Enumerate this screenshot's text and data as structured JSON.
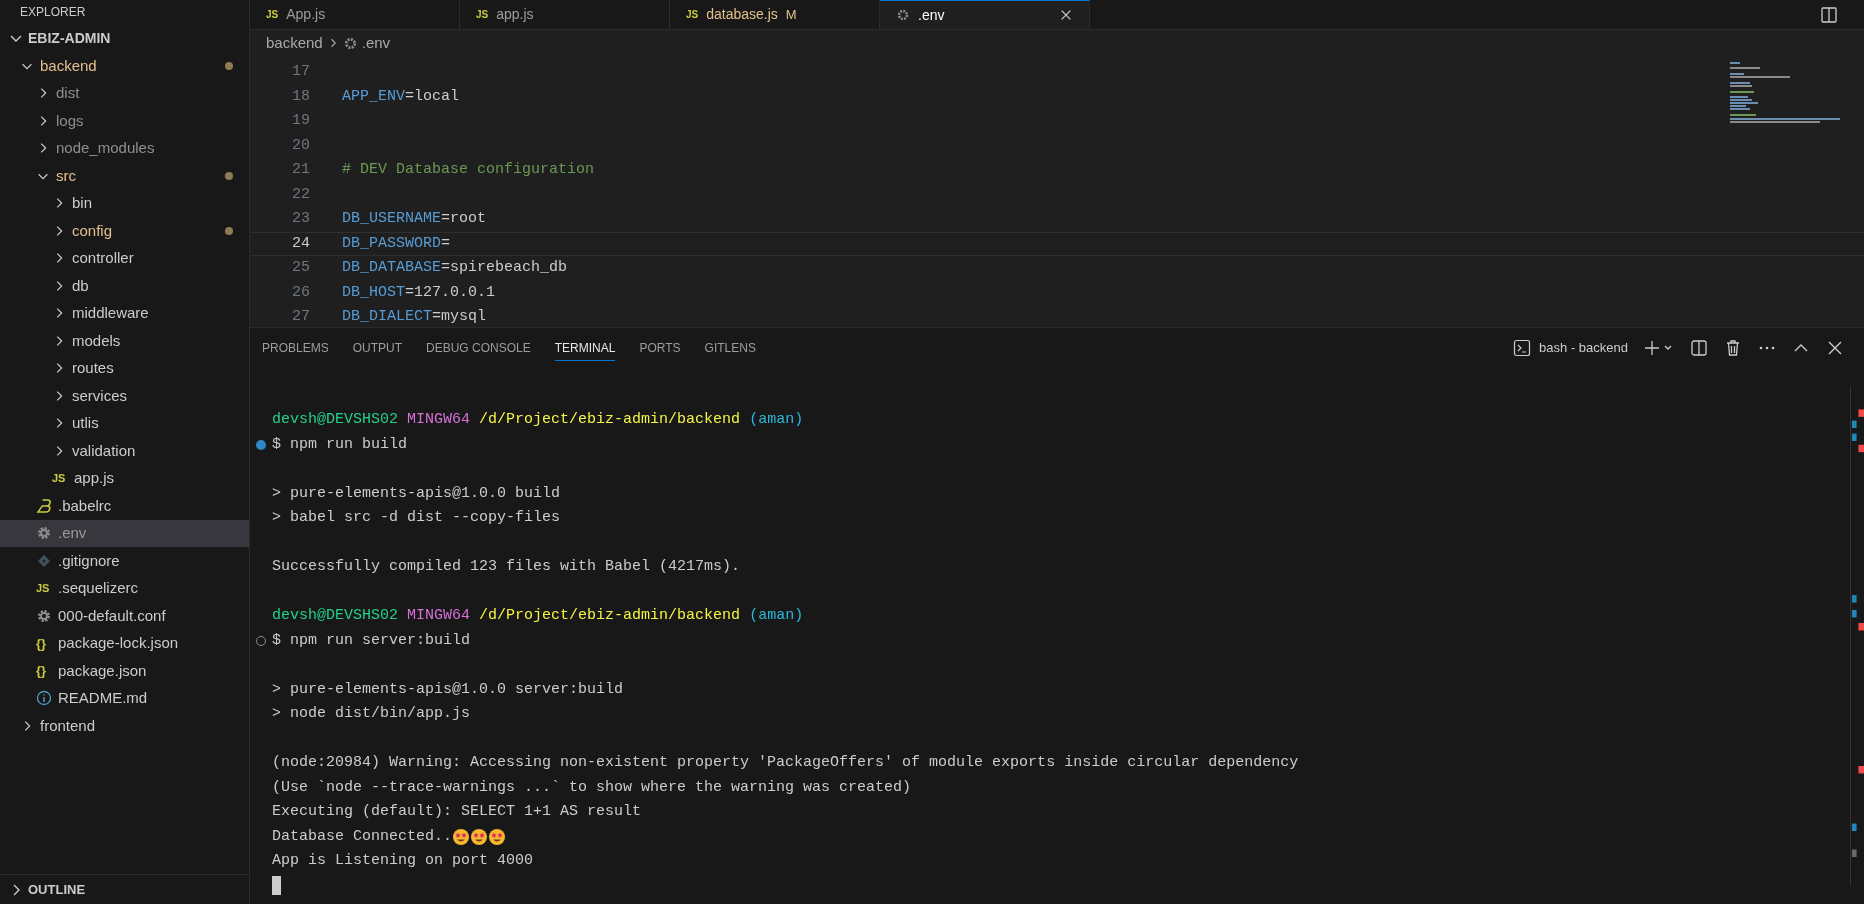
{
  "sidebar": {
    "title": "EXPLORER",
    "root": "EBIZ-ADMIN",
    "tree": [
      {
        "label": "backend",
        "kind": "folder",
        "expanded": true,
        "modified": true,
        "ignored": false,
        "selected": false,
        "children": [
          {
            "label": "dist",
            "kind": "folder",
            "expanded": false,
            "modified": false,
            "ignored": true,
            "selected": false
          },
          {
            "label": "logs",
            "kind": "folder",
            "expanded": false,
            "modified": false,
            "ignored": true,
            "selected": false
          },
          {
            "label": "node_modules",
            "kind": "folder",
            "expanded": false,
            "modified": false,
            "ignored": true,
            "selected": false
          },
          {
            "label": "src",
            "kind": "folder",
            "expanded": true,
            "modified": true,
            "ignored": false,
            "selected": false,
            "children": [
              {
                "label": "bin",
                "kind": "folder",
                "expanded": false,
                "modified": false,
                "ignored": false,
                "selected": false
              },
              {
                "label": "config",
                "kind": "folder",
                "expanded": false,
                "modified": true,
                "ignored": false,
                "selected": false
              },
              {
                "label": "controller",
                "kind": "folder",
                "expanded": false,
                "modified": false,
                "ignored": false,
                "selected": false
              },
              {
                "label": "db",
                "kind": "folder",
                "expanded": false,
                "modified": false,
                "ignored": false,
                "selected": false
              },
              {
                "label": "middleware",
                "kind": "folder",
                "expanded": false,
                "modified": false,
                "ignored": false,
                "selected": false
              },
              {
                "label": "models",
                "kind": "folder",
                "expanded": false,
                "modified": false,
                "ignored": false,
                "selected": false
              },
              {
                "label": "routes",
                "kind": "folder",
                "expanded": false,
                "modified": false,
                "ignored": false,
                "selected": false
              },
              {
                "label": "services",
                "kind": "folder",
                "expanded": false,
                "modified": false,
                "ignored": false,
                "selected": false
              },
              {
                "label": "utlis",
                "kind": "folder",
                "expanded": false,
                "modified": false,
                "ignored": false,
                "selected": false
              },
              {
                "label": "validation",
                "kind": "folder",
                "expanded": false,
                "modified": false,
                "ignored": false,
                "selected": false
              },
              {
                "label": "app.js",
                "kind": "js",
                "icon": "JS",
                "modified": false,
                "ignored": false,
                "selected": false
              }
            ]
          },
          {
            "label": ".babelrc",
            "kind": "babel",
            "modified": false,
            "ignored": false,
            "selected": false
          },
          {
            "label": ".env",
            "kind": "gear",
            "modified": false,
            "ignored": true,
            "selected": true
          },
          {
            "label": ".gitignore",
            "kind": "git",
            "modified": false,
            "ignored": false,
            "selected": false
          },
          {
            "label": ".sequelizerc",
            "kind": "js",
            "icon": "JS",
            "modified": false,
            "ignored": false,
            "selected": false
          },
          {
            "label": "000-default.conf",
            "kind": "gear",
            "modified": false,
            "ignored": false,
            "selected": false
          },
          {
            "label": "package-lock.json",
            "kind": "json",
            "icon": "{}",
            "modified": false,
            "ignored": false,
            "selected": false
          },
          {
            "label": "package.json",
            "kind": "json",
            "icon": "{}",
            "modified": false,
            "ignored": false,
            "selected": false
          },
          {
            "label": "README.md",
            "kind": "info",
            "modified": false,
            "ignored": false,
            "selected": false
          }
        ]
      },
      {
        "label": "frontend",
        "kind": "folder",
        "expanded": false,
        "modified": false,
        "ignored": false,
        "selected": false
      }
    ],
    "outline": {
      "label": "OUTLINE",
      "expanded": false
    }
  },
  "tabs": [
    {
      "label": "App.js",
      "icon": "JS",
      "selected": false,
      "modified": false
    },
    {
      "label": "app.js",
      "icon": "JS",
      "selected": false,
      "modified": false
    },
    {
      "label": "database.js",
      "icon": "JS",
      "badge": "M",
      "selected": false,
      "modified": true
    },
    {
      "label": ".env",
      "selected": true,
      "modified": false
    }
  ],
  "breadcrumb": [
    "backend",
    ".env"
  ],
  "editor": {
    "lines": [
      {
        "number": "17",
        "kind": "blank",
        "selected": false
      },
      {
        "number": "18",
        "kind": "var",
        "key": "APP_ENV",
        "value": "=local",
        "selected": false
      },
      {
        "number": "19",
        "kind": "blank",
        "selected": false
      },
      {
        "number": "20",
        "kind": "blank",
        "selected": false
      },
      {
        "number": "21",
        "kind": "comment",
        "text": "# DEV Database configuration",
        "selected": false
      },
      {
        "number": "22",
        "kind": "blank",
        "selected": false
      },
      {
        "number": "23",
        "kind": "var",
        "key": "DB_USERNAME",
        "value": "=root",
        "selected": false
      },
      {
        "number": "24",
        "kind": "var",
        "key": "DB_PASSWORD",
        "value": "=",
        "selected": true
      },
      {
        "number": "25",
        "kind": "var",
        "key": "DB_DATABASE",
        "value": "=spirebeach_db",
        "selected": false
      },
      {
        "number": "26",
        "kind": "var",
        "key": "DB_HOST",
        "value": "=127.0.0.1",
        "selected": false
      },
      {
        "number": "27",
        "kind": "var",
        "key": "DB_DIALECT",
        "value": "=mysql",
        "selected": false
      }
    ]
  },
  "panel": {
    "tabs": [
      {
        "label": "PROBLEMS",
        "selected": false
      },
      {
        "label": "OUTPUT",
        "selected": false
      },
      {
        "label": "DEBUG CONSOLE",
        "selected": false
      },
      {
        "label": "TERMINAL",
        "selected": true
      },
      {
        "label": "PORTS",
        "selected": false
      },
      {
        "label": "GITLENS",
        "selected": false
      }
    ],
    "terminal_name": "bash - backend",
    "lines": [
      {
        "kind": "prompt",
        "user": "devsh@DEVSHS02",
        "system": "MINGW64",
        "path": "/d/Project/ebiz-admin/backend",
        "branch": "(aman)"
      },
      {
        "kind": "command",
        "succeeded": true,
        "text": "$ npm run build"
      },
      {
        "kind": "blank"
      },
      {
        "kind": "output",
        "text": "> pure-elements-apis@1.0.0 build"
      },
      {
        "kind": "output",
        "text": "> babel src -d dist --copy-files"
      },
      {
        "kind": "blank"
      },
      {
        "kind": "output",
        "text": "Successfully compiled 123 files with Babel (4217ms)."
      },
      {
        "kind": "blank"
      },
      {
        "kind": "prompt",
        "user": "devsh@DEVSHS02",
        "system": "MINGW64",
        "path": "/d/Project/ebiz-admin/backend",
        "branch": "(aman)"
      },
      {
        "kind": "command",
        "succeeded": false,
        "text": "$ npm run server:build"
      },
      {
        "kind": "blank"
      },
      {
        "kind": "output",
        "text": "> pure-elements-apis@1.0.0 server:build"
      },
      {
        "kind": "output",
        "text": "> node dist/bin/app.js"
      },
      {
        "kind": "blank"
      },
      {
        "kind": "output",
        "text": "(node:20984) Warning: Accessing non-existent property 'PackageOffers' of module exports inside circular dependency"
      },
      {
        "kind": "output",
        "text": "(Use `node --trace-warnings ...` to show where the warning was created)"
      },
      {
        "kind": "output",
        "text": "Executing (default): SELECT 1+1 AS result"
      },
      {
        "kind": "emoji_output",
        "text": "Database Connected.."
      },
      {
        "kind": "output",
        "text": "App is Listening on port 4000"
      },
      {
        "kind": "cursor"
      }
    ]
  }
}
